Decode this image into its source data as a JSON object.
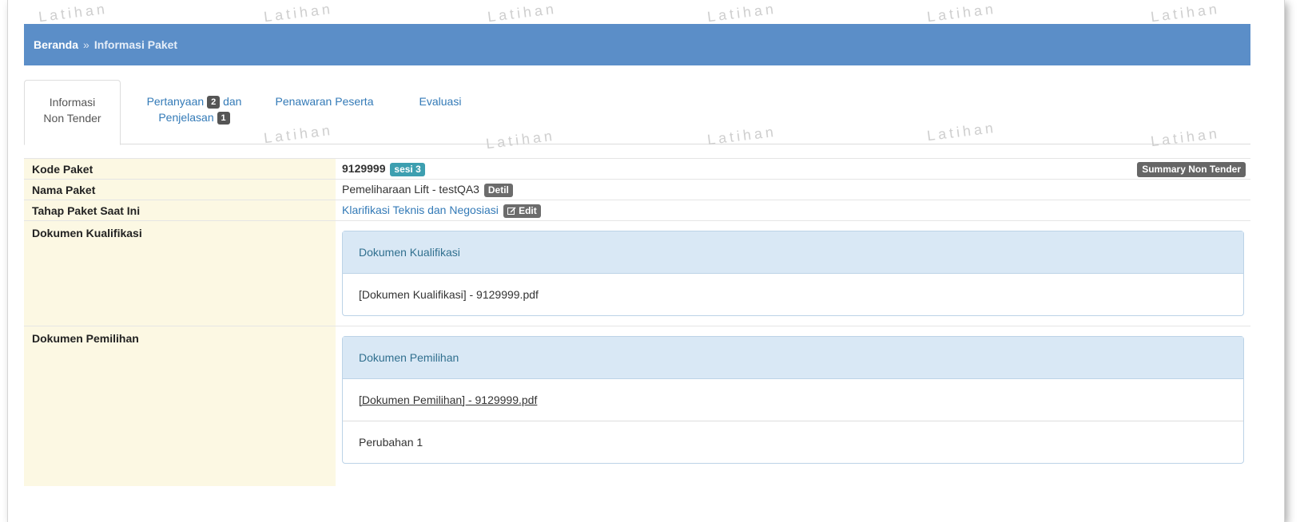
{
  "breadcrumb": {
    "home": "Beranda",
    "separator": "»",
    "current": "Informasi Paket"
  },
  "tabs": [
    {
      "line1": "Informasi",
      "line2": "Non Tender"
    },
    {
      "line1a": "Pertanyaan",
      "badge1": "2",
      "line1b": "dan",
      "line2": "Penjelasan",
      "badge2": "1"
    },
    {
      "label": "Penawaran Peserta"
    },
    {
      "label": "Evaluasi"
    }
  ],
  "info": {
    "kode_paket": {
      "label": "Kode Paket",
      "value": "9129999",
      "badge": "sesi 3",
      "summary_button": "Summary Non Tender"
    },
    "nama_paket": {
      "label": "Nama Paket",
      "value": "Pemeliharaan Lift - testQA3",
      "detail_button": "Detil"
    },
    "tahap": {
      "label": "Tahap Paket Saat Ini",
      "value": "Klarifikasi Teknis dan Negosiasi",
      "edit_button": "Edit"
    },
    "dok_kualifikasi": {
      "label": "Dokumen Kualifikasi",
      "panel_title": "Dokumen Kualifikasi",
      "file": "[Dokumen Kualifikasi] - 9129999.pdf"
    },
    "dok_pemilihan": {
      "label": "Dokumen Pemilihan",
      "panel_title": "Dokumen Pemilihan",
      "file": "[Dokumen Pemilihan] - 9129999.pdf",
      "revision": "Perubahan 1"
    }
  },
  "watermark_text": "Latihan",
  "colors": {
    "header_bar": "#5b8ec8",
    "label_bg": "#fcf8e3",
    "panel_heading": "#d9e8f5",
    "link": "#337ab7",
    "badge_teal": "#3d9fb0"
  },
  "icons": {
    "edit": "edit-icon"
  }
}
